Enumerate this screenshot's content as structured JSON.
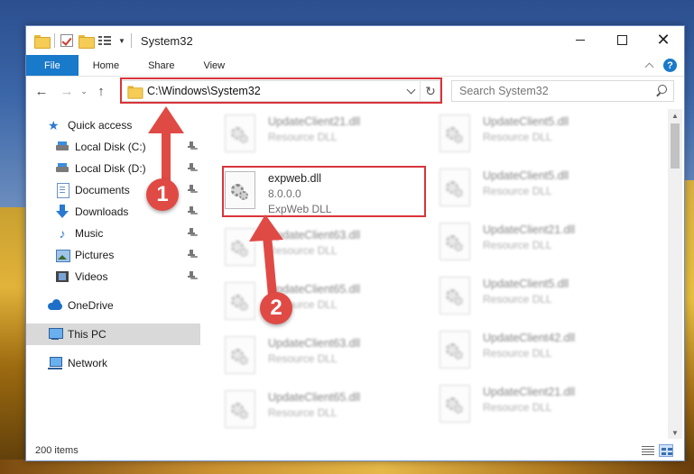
{
  "window": {
    "title": "System32",
    "controls": {
      "minimize": "",
      "maximize": "",
      "close": "✕"
    }
  },
  "ribbon": {
    "tabs": [
      "File",
      "Home",
      "Share",
      "View"
    ],
    "help": "?"
  },
  "navbar": {
    "back": "←",
    "forward": "→",
    "recent": "⌄",
    "up": "↑",
    "address": "C:\\Windows\\System32",
    "refresh": "↻",
    "search_placeholder": "Search System32"
  },
  "nav_pane": {
    "items": [
      {
        "label": "Quick access",
        "icon": "star-icon"
      },
      {
        "label": "Local Disk (C:)",
        "icon": "disk-icon",
        "pinned": true
      },
      {
        "label": "Local Disk (D:)",
        "icon": "disk-icon",
        "pinned": true
      },
      {
        "label": "Documents",
        "icon": "documents-icon",
        "pinned": true
      },
      {
        "label": "Downloads",
        "icon": "downloads-icon",
        "pinned": true
      },
      {
        "label": "Music",
        "icon": "music-icon",
        "pinned": true
      },
      {
        "label": "Pictures",
        "icon": "pictures-icon",
        "pinned": true
      },
      {
        "label": "Videos",
        "icon": "videos-icon",
        "pinned": true
      },
      {
        "label": "OneDrive",
        "icon": "onedrive-icon"
      },
      {
        "label": "This PC",
        "icon": "this-pc-icon",
        "selected": true
      },
      {
        "label": "Network",
        "icon": "network-icon"
      }
    ]
  },
  "files": {
    "left": [
      {
        "name": "UpdateClient21.dll",
        "type": "Resource DLL"
      },
      {
        "name": "expweb.dll",
        "version": "8.0.0.0",
        "type": "ExpWeb DLL"
      },
      {
        "name": "UpdateClient63.dll",
        "type": "Resource DLL"
      },
      {
        "name": "UpdateClient65.dll",
        "type": "Resource DLL"
      },
      {
        "name": "UpdateClient63.dll",
        "type": "Resource DLL"
      },
      {
        "name": "UpdateClient65.dll",
        "type": "Resource DLL"
      }
    ],
    "right": [
      {
        "name": "UpdateClient5.dll",
        "type": "Resource DLL"
      },
      {
        "name": "UpdateClient5.dll",
        "type": "Resource DLL"
      },
      {
        "name": "UpdateClient21.dll",
        "type": "Resource DLL"
      },
      {
        "name": "UpdateClient5.dll",
        "type": "Resource DLL"
      },
      {
        "name": "UpdateClient42.dll",
        "type": "Resource DLL"
      },
      {
        "name": "UpdateClient21.dll",
        "type": "Resource DLL"
      }
    ]
  },
  "status": {
    "item_count": "200 items"
  },
  "callouts": [
    "1",
    "2"
  ],
  "colors": {
    "accent": "#1979ca",
    "highlight": "#d9343a",
    "callout": "#e04a45"
  }
}
